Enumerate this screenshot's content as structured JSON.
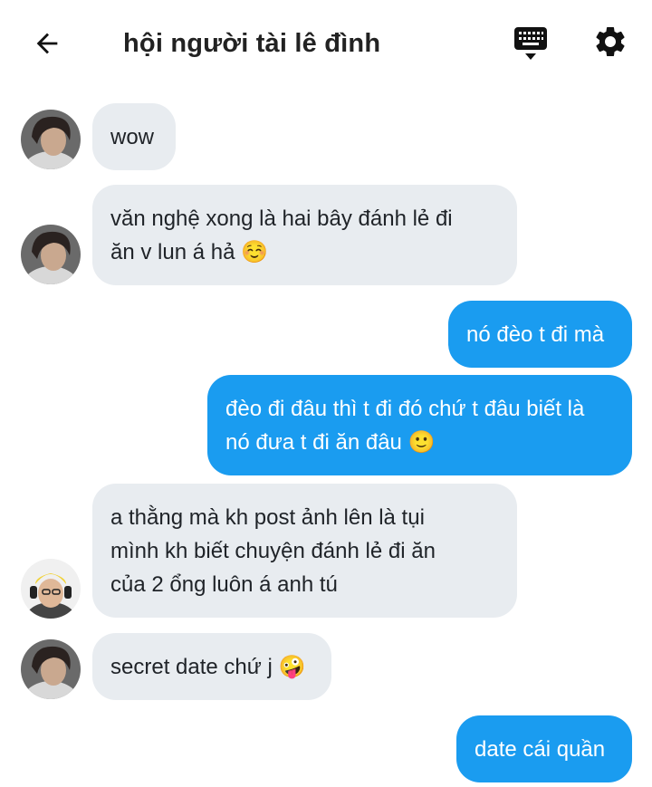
{
  "header": {
    "title": "hội người tài lê đình",
    "back_icon": "arrow-left-icon",
    "keyboard_icon": "keyboard-icon",
    "settings_icon": "gear-icon"
  },
  "colors": {
    "incoming_bubble": "#e8ecf0",
    "outgoing_bubble": "#1a9cf0"
  },
  "messages": [
    {
      "direction": "incoming",
      "text": "wow"
    },
    {
      "direction": "incoming",
      "text": "văn nghệ xong là hai bây đánh lẻ đi\năn v lun á hả ☺️"
    },
    {
      "direction": "outgoing",
      "text": "nó đèo t đi mà"
    },
    {
      "direction": "outgoing",
      "text": "đèo đi đâu thì t đi đó chứ t đâu biết là\nnó đưa t đi ăn đâu 🙂"
    },
    {
      "direction": "incoming",
      "text": "a thằng mà kh post ảnh lên là tụi\nmình kh biết chuyện đánh lẻ đi ăn\ncủa 2 ổng luôn á anh tú"
    },
    {
      "direction": "incoming",
      "text": "secret date chứ j 🤪"
    },
    {
      "direction": "outgoing",
      "text": "date cái quần"
    }
  ]
}
